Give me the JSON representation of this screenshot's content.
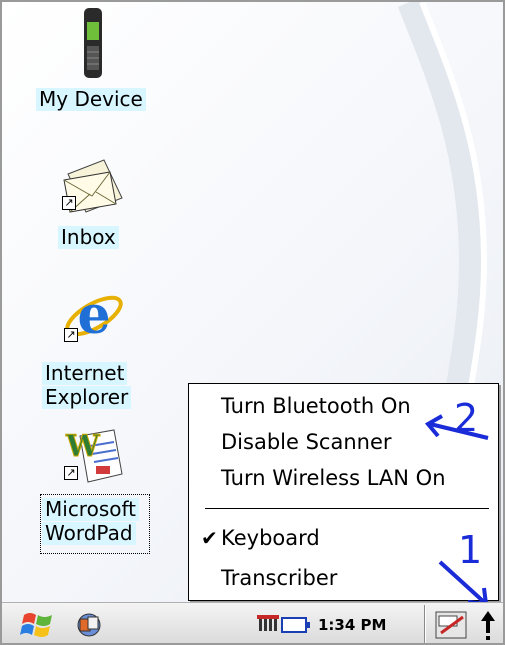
{
  "desktop": {
    "icons": [
      {
        "id": "my-device",
        "label": "My Device"
      },
      {
        "id": "inbox",
        "label": "Inbox"
      },
      {
        "id": "internet-explorer",
        "label_line1": "Internet",
        "label_line2": "Explorer"
      },
      {
        "id": "wordpad",
        "label_line1": "Microsoft",
        "label_line2": "WordPad"
      }
    ]
  },
  "menu": {
    "items": [
      {
        "label": "Turn Bluetooth On",
        "checked": false
      },
      {
        "label": "Disable Scanner",
        "checked": false
      },
      {
        "label": "Turn Wireless LAN On",
        "checked": false
      },
      {
        "label": "Keyboard",
        "checked": true
      },
      {
        "label": "Transcriber",
        "checked": false
      }
    ],
    "check_glyph": "✔"
  },
  "annotations": {
    "callout_1": "1",
    "callout_2": "2",
    "color": "#1a2bd8"
  },
  "taskbar": {
    "clock": "1:34 PM",
    "icons": [
      "windows-start-icon",
      "app-switcher-icon",
      "signal-icon",
      "battery-icon",
      "input-panel-icon",
      "up-arrow-icon"
    ]
  },
  "colors": {
    "label_highlight": "#d8f6ff",
    "annotation": "#1a2bd8"
  }
}
